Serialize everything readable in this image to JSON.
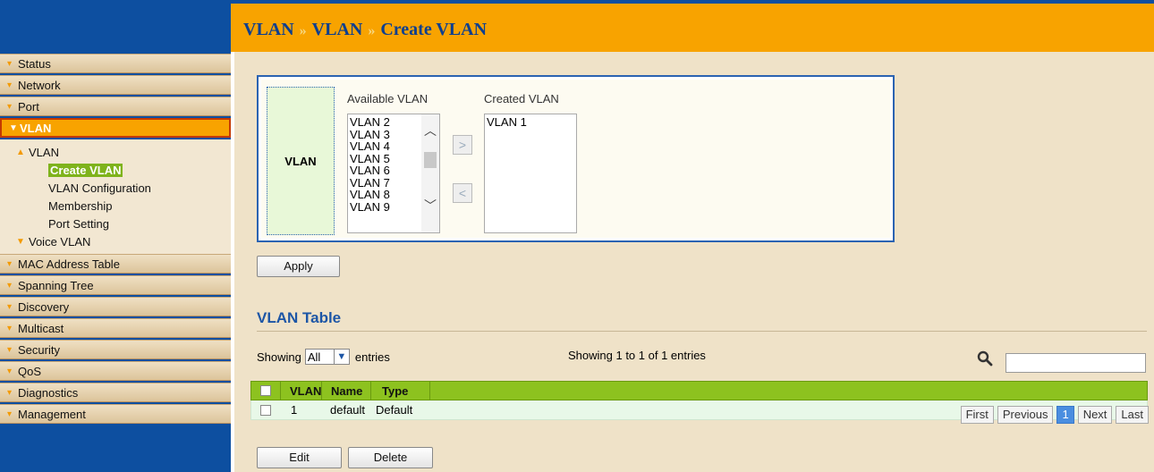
{
  "breadcrumb": {
    "part1": "VLAN",
    "part2": "VLAN",
    "part3": "Create VLAN",
    "separator": "»"
  },
  "sidebar": {
    "items_top": [
      {
        "label": "Status"
      },
      {
        "label": "Network"
      },
      {
        "label": "Port"
      }
    ],
    "active": {
      "label": "VLAN"
    },
    "submenu": {
      "group_label": "VLAN",
      "children": [
        "Create VLAN",
        "VLAN Configuration",
        "Membership",
        "Port Setting"
      ],
      "selected": "Create VLAN",
      "voice_label": "Voice VLAN"
    },
    "items_bottom": [
      {
        "label": "MAC Address Table"
      },
      {
        "label": "Spanning Tree"
      },
      {
        "label": "Discovery"
      },
      {
        "label": "Multicast"
      },
      {
        "label": "Security"
      },
      {
        "label": "QoS"
      },
      {
        "label": "Diagnostics"
      },
      {
        "label": "Management"
      }
    ]
  },
  "form": {
    "vlan_label": "VLAN",
    "available_label": "Available VLAN",
    "created_label": "Created VLAN",
    "available_options": [
      "VLAN 2",
      "VLAN 3",
      "VLAN 4",
      "VLAN 5",
      "VLAN 6",
      "VLAN 7",
      "VLAN 8",
      "VLAN 9"
    ],
    "created_options": [
      "VLAN 1"
    ],
    "move_right_label": ">",
    "move_left_label": "<",
    "apply_label": "Apply"
  },
  "table_section": {
    "title": "VLAN Table",
    "showing_prefix": "Showing",
    "showing_value": "All",
    "showing_suffix": "entries",
    "status_text": "Showing 1 to 1 of 1 entries",
    "search_placeholder": "",
    "columns": [
      "VLAN",
      "Name",
      "Type"
    ],
    "rows": [
      {
        "vlan": "1",
        "name": "default",
        "type": "Default"
      }
    ],
    "pager": {
      "first": "First",
      "previous": "Previous",
      "current": "1",
      "next": "Next",
      "last": "Last"
    },
    "edit_label": "Edit",
    "delete_label": "Delete"
  },
  "colors": {
    "header": "#f8a300",
    "sidebar": "#0d4fa0",
    "accent_green": "#8dc21f",
    "title_blue": "#1d56a6"
  }
}
